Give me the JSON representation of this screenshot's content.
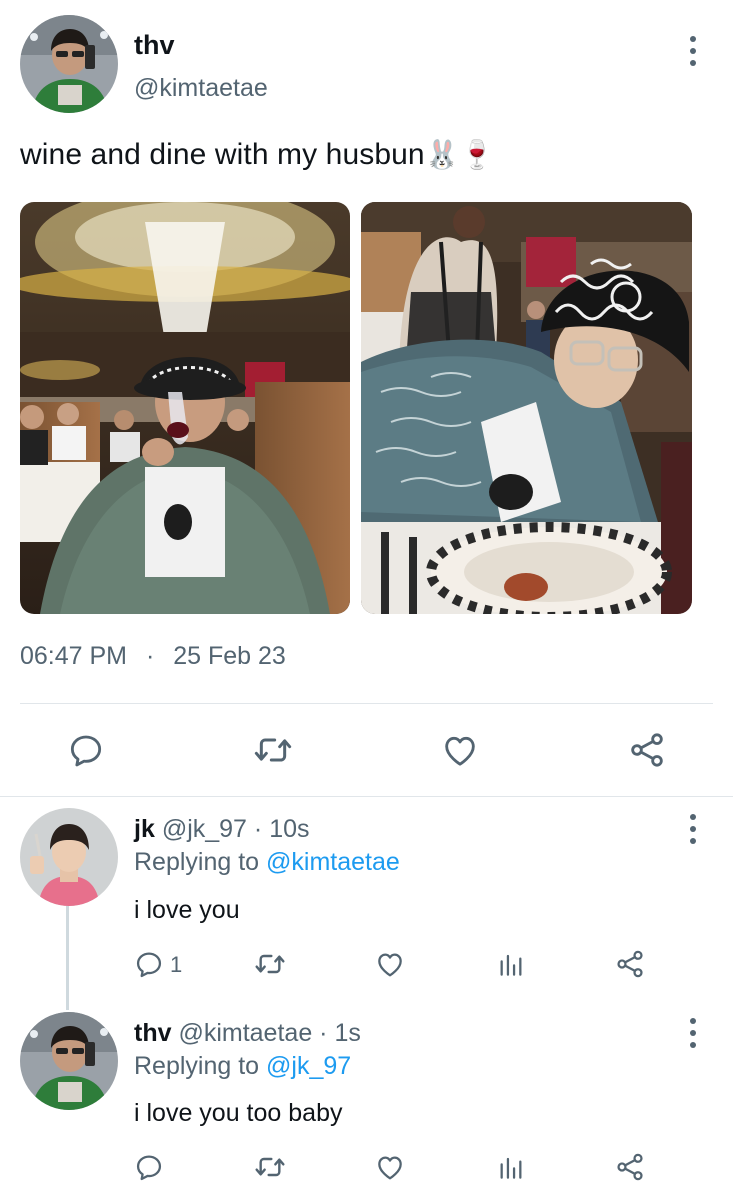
{
  "tweet": {
    "author_name": "thv",
    "author_handle": "@kimtaetae",
    "text": "wine and dine with my husbun",
    "emoji": "🐰🍷",
    "time": "06:47 PM",
    "separator": "·",
    "date": "25 Feb 23"
  },
  "replies": [
    {
      "name": "jk",
      "handle": "@jk_97",
      "dot": "·",
      "age": "10s",
      "replying_prefix": "Replying to",
      "replying_to": "@kimtaetae",
      "text": "i love you",
      "reply_count": "1"
    },
    {
      "name": "thv",
      "handle": "@kimtaetae",
      "dot": "·",
      "age": "1s",
      "replying_prefix": "Replying to",
      "replying_to": "@jk_97",
      "text": "i love you too baby",
      "reply_count": ""
    }
  ],
  "colors": {
    "text": "#0f1419",
    "secondary": "#536471",
    "accent": "#1d9bf0",
    "divider": "#e1e6ea"
  },
  "icons": [
    "reply-icon",
    "retweet-icon",
    "like-icon",
    "share-icon",
    "analytics-icon",
    "more-icon"
  ]
}
